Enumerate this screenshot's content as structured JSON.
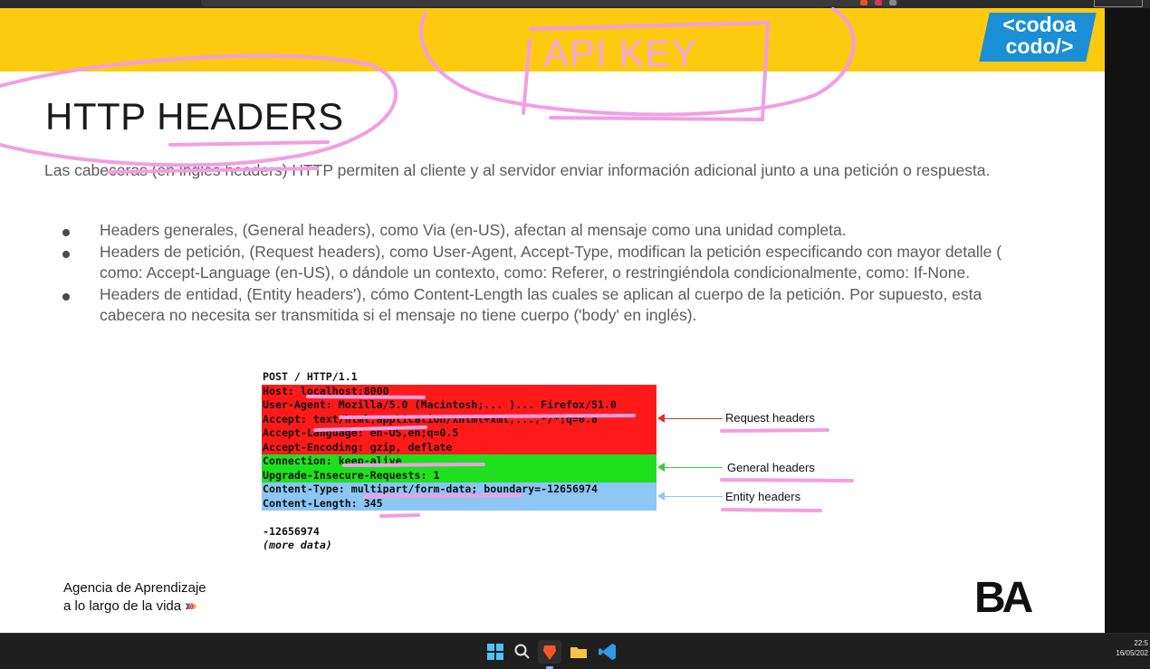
{
  "slide": {
    "logo_line1": "<codoa",
    "logo_line2": "codo/>",
    "title": "HTTP HEADERS",
    "intro": "Las cabeceras (en inglés headers) HTTP permiten al cliente y al servidor enviar información adicional junto a una petición o respuesta.",
    "bullets": [
      "Headers generales, (General headers), como Via (en-US),  afectan al mensaje como una unidad completa.",
      "Headers de petición, (Request headers), como User-Agent, Accept-Type, modifican la petición especificando con mayor detalle ( como: Accept-Language (en-US), o dándole un contexto, como:  Referer, o restringiéndola condicionalmente, como: If-None.",
      "Headers de entidad, (Entity headers'), cómo Content-Length las cuales se aplican al cuerpo de la petición. Por supuesto, esta cabecera no necesita ser transmitida si el mensaje no tiene cuerpo ('body' en inglés)."
    ],
    "code_lines": [
      "POST / HTTP/1.1",
      "Host: localhost:8000",
      "User-Agent: Mozilla/5.0 (Macintosh;... )... Firefox/51.0",
      "Accept: text/html,application/xhtml+xml,...,*/*;q=0.8",
      "Accept-Language: en-US,en;q=0.5",
      "Accept-Encoding: gzip, deflate",
      "Connection: keep-alive",
      "Upgrade-Insecure-Requests: 1",
      "Content-Type: multipart/form-data; boundary=-12656974",
      "Content-Length: 345",
      "",
      "-12656974",
      "(more data)"
    ],
    "callouts": {
      "request": "Request headers",
      "general": "General headers",
      "entity": "Entity headers"
    },
    "footer_line1": "Agencia de Aprendizaje",
    "footer_line2": "a lo largo de la vida",
    "footer_logo": "BA"
  },
  "annotation": {
    "handwritten_text": "API KEY",
    "color": "#f2a7e6"
  },
  "colors": {
    "band": "#fdca10",
    "request": "#ff1a1a",
    "general": "#1ee01e",
    "entity": "#8cc6f5",
    "logo": "#1a8fd6"
  },
  "taskbar": {
    "icons": [
      "windows-start-icon",
      "search-icon",
      "brave-browser-icon",
      "file-explorer-icon",
      "vscode-icon"
    ]
  },
  "clock": {
    "time": "22:5",
    "date": "16/05/202"
  }
}
